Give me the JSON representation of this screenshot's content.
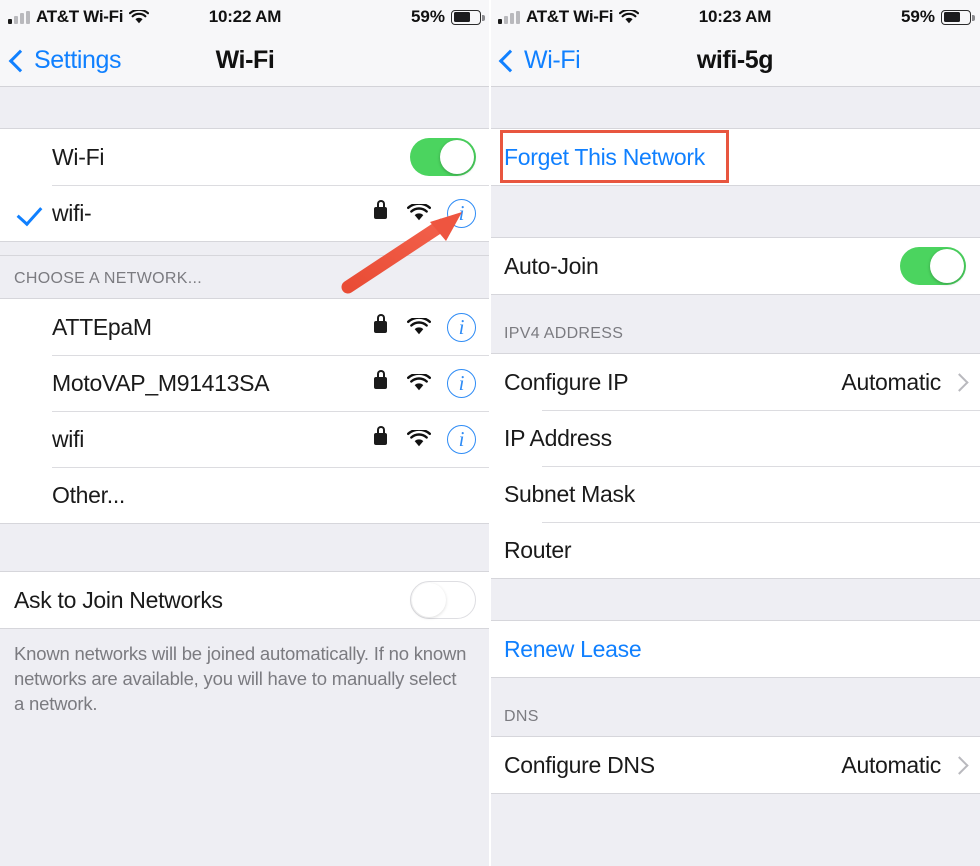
{
  "left_phone": {
    "status_bar": {
      "carrier": "AT&T Wi-Fi",
      "time": "10:22 AM",
      "battery_percent": "59%",
      "battery_level": 59,
      "signal_icon": "signal-bars-icon",
      "wifi_icon": "wifi-icon",
      "battery_icon": "battery-icon"
    },
    "nav": {
      "back_label": "Settings",
      "back_icon": "chevron-left-icon",
      "title": "Wi-Fi"
    },
    "wifi_toggle": {
      "label": "Wi-Fi",
      "state": "on"
    },
    "connected_network": {
      "name": "wifi-",
      "checkmark_icon": "checkmark-icon",
      "lock_icon": "lock-icon",
      "signal_icon": "wifi-icon",
      "info_icon": "info-circle-icon"
    },
    "choose_network_header": "CHOOSE A NETWORK...",
    "networks": [
      {
        "name": "ATTEpaM",
        "secured": true
      },
      {
        "name": "MotoVAP_M91413SA",
        "secured": true
      },
      {
        "name": "wifi",
        "secured": true
      },
      {
        "name": "Other...",
        "secured": false
      }
    ],
    "ask_to_join": {
      "label": "Ask to Join Networks",
      "state": "off"
    },
    "footnote": "Known networks will be joined automatically. If no known networks are available, you will have to manually select a network."
  },
  "right_phone": {
    "status_bar": {
      "carrier": "AT&T Wi-Fi",
      "time": "10:23 AM",
      "battery_percent": "59%",
      "battery_level": 59,
      "signal_icon": "signal-bars-icon",
      "wifi_icon": "wifi-icon",
      "battery_icon": "battery-icon"
    },
    "nav": {
      "back_label": "Wi-Fi",
      "back_icon": "chevron-left-icon",
      "title": "wifi-5g"
    },
    "forget_network": {
      "label": "Forget This Network",
      "highlighted": true
    },
    "auto_join": {
      "label": "Auto-Join",
      "state": "on"
    },
    "ipv4_header": "IPV4 ADDRESS",
    "ipv4_rows": [
      {
        "label": "Configure IP",
        "value": "Automatic",
        "chevron": true
      },
      {
        "label": "IP Address",
        "value": "",
        "chevron": false
      },
      {
        "label": "Subnet Mask",
        "value": "",
        "chevron": false
      },
      {
        "label": "Router",
        "value": "",
        "chevron": false
      }
    ],
    "renew_lease": {
      "label": "Renew Lease"
    },
    "dns_header": "DNS",
    "dns_rows": [
      {
        "label": "Configure DNS",
        "value": "Automatic",
        "chevron": true
      }
    ]
  },
  "annotations": {
    "arrow": {
      "icon": "red-arrow-annotation",
      "color": "#ee5540",
      "points_to": "info-circle-icon"
    },
    "highlight_box": {
      "icon": "red-highlight-box",
      "color": "#e8563f",
      "surrounds": "Forget This Network"
    }
  },
  "colors": {
    "accent_blue": "#1080ff",
    "toggle_green": "#4bd45f",
    "annotation_red": "#e8563f",
    "group_bg": "#eeeef3"
  }
}
